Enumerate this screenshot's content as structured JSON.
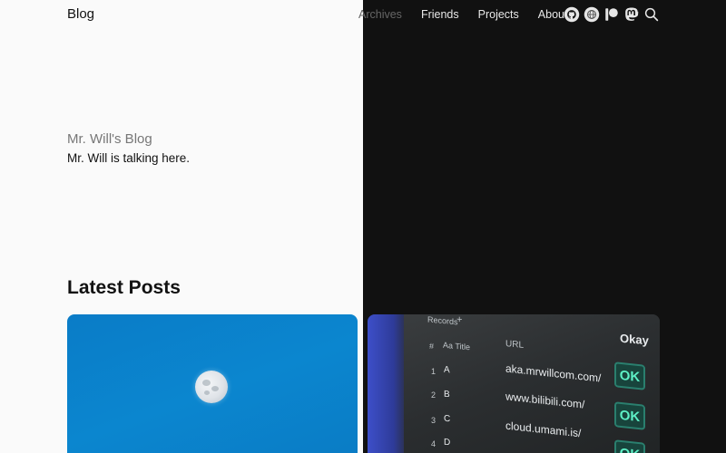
{
  "header": {
    "brand": "Blog",
    "nav": [
      {
        "label": "Archives"
      },
      {
        "label": "Friends"
      },
      {
        "label": "Projects"
      },
      {
        "label": "About"
      }
    ],
    "icons": [
      "github-icon",
      "globe-icon",
      "patreon-icon",
      "mastodon-icon",
      "search-icon"
    ]
  },
  "hero": {
    "title": "Mr. Will's Blog",
    "subtitle": "Mr. Will is talking here."
  },
  "latest": {
    "title": "Latest Posts"
  },
  "card2": {
    "tab": "Records",
    "headers": {
      "num": "#",
      "title": "Aa Title",
      "url": "URL",
      "status": "Okay"
    },
    "rows": [
      {
        "num": "1",
        "letter": "A",
        "url": "aka.mrwillcom.com/",
        "status": "OK"
      },
      {
        "num": "2",
        "letter": "B",
        "url": "www.bilibili.com/",
        "status": "OK"
      },
      {
        "num": "3",
        "letter": "C",
        "url": "cloud.umami.is/",
        "status": "OK"
      },
      {
        "num": "4",
        "letter": "D"
      }
    ]
  },
  "colors": {
    "left_bg": "#fafafa",
    "right_bg": "#111111",
    "card1_bg": "#0b86cf",
    "ok_green": "#5ef0c6"
  }
}
